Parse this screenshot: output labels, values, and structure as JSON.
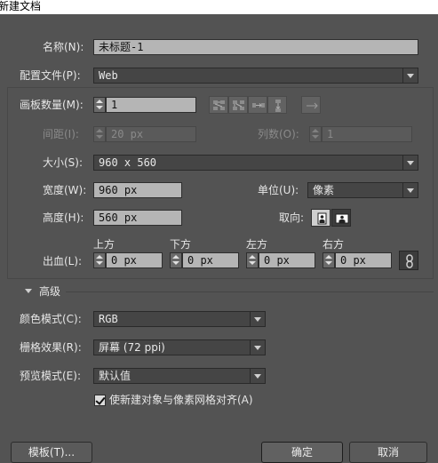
{
  "window": {
    "title": "新建文档"
  },
  "name": {
    "label": "名称(N):",
    "value": "未标题-1"
  },
  "profile": {
    "label": "配置文件(P):",
    "value": "Web"
  },
  "artboards": {
    "label": "画板数量(M):",
    "value": "1"
  },
  "spacing": {
    "label": "间距(I):",
    "value": "20 px"
  },
  "columns": {
    "label": "列数(O):",
    "value": "1"
  },
  "size": {
    "label": "大小(S):",
    "value": "960 x 560"
  },
  "width": {
    "label": "宽度(W):",
    "value": "960 px"
  },
  "units": {
    "label": "单位(U):",
    "value": "像素"
  },
  "height": {
    "label": "高度(H):",
    "value": "560 px"
  },
  "orientation": {
    "label": "取向:"
  },
  "bleed": {
    "label": "出血(L):",
    "top_label": "上方",
    "top": "0 px",
    "bottom_label": "下方",
    "bottom": "0 px",
    "left_label": "左方",
    "left": "0 px",
    "right_label": "右方",
    "right": "0 px"
  },
  "advanced": {
    "label": "高级"
  },
  "color_mode": {
    "label": "颜色模式(C):",
    "value": "RGB"
  },
  "raster_effects": {
    "label": "栅格效果(R):",
    "value": "屏幕 (72 ppi)"
  },
  "preview_mode": {
    "label": "预览模式(E):",
    "value": "默认值"
  },
  "align_pixel": {
    "label": "使新建对象与像素网格对齐(A)",
    "checked": true
  },
  "buttons": {
    "templates": "模板(T)...",
    "ok": "确定",
    "cancel": "取消"
  },
  "colors": {
    "background": "#535353",
    "field": "#b5b5b5",
    "dropdown": "#454545"
  }
}
